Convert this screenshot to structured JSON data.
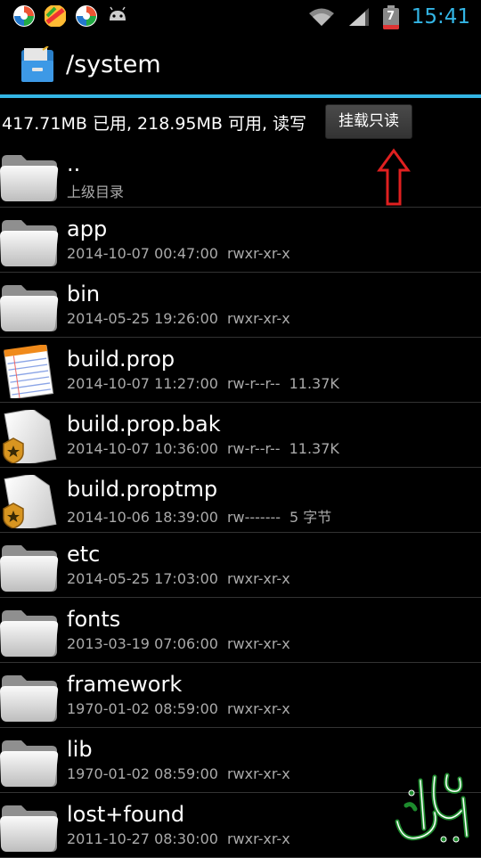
{
  "status_bar": {
    "time": "15:41",
    "battery_level": "7",
    "notification_icons": [
      "app-icon-1",
      "app-icon-2",
      "app-icon-3",
      "android-icon"
    ]
  },
  "header": {
    "title": "/system"
  },
  "storage": {
    "info": "417.71MB 已用, 218.95MB 可用, 读写",
    "mount_button": "挂载只读"
  },
  "files": [
    {
      "name": "..",
      "date": "上级目录",
      "perm": "",
      "size": "",
      "icon": "folder-icon"
    },
    {
      "name": "app",
      "date": "2014-10-07 00:47:00",
      "perm": "rwxr-xr-x",
      "size": "",
      "icon": "folder-icon"
    },
    {
      "name": "bin",
      "date": "2014-05-25 19:26:00",
      "perm": "rwxr-xr-x",
      "size": "",
      "icon": "folder-icon"
    },
    {
      "name": "build.prop",
      "date": "2014-10-07 11:27:00",
      "perm": "rw-r--r--",
      "size": "11.37K",
      "icon": "notepad-icon"
    },
    {
      "name": "build.prop.bak",
      "date": "2014-10-07 10:36:00",
      "perm": "rw-r--r--",
      "size": "11.37K",
      "icon": "file-badge-icon"
    },
    {
      "name": "build.proptmp",
      "date": "2014-10-06 18:39:00",
      "perm": "rw-------",
      "size": "5 字节",
      "icon": "file-badge-icon"
    },
    {
      "name": "etc",
      "date": "2014-05-25 17:03:00",
      "perm": "rwxr-xr-x",
      "size": "",
      "icon": "folder-icon"
    },
    {
      "name": "fonts",
      "date": "2013-03-19 07:06:00",
      "perm": "rwxr-xr-x",
      "size": "",
      "icon": "folder-icon"
    },
    {
      "name": "framework",
      "date": "1970-01-02 08:59:00",
      "perm": "rwxr-xr-x",
      "size": "",
      "icon": "folder-icon"
    },
    {
      "name": "lib",
      "date": "1970-01-02 08:59:00",
      "perm": "rwxr-xr-x",
      "size": "",
      "icon": "folder-icon"
    },
    {
      "name": "lost+found",
      "date": "2011-10-27 08:30:00",
      "perm": "rwxr-xr-x",
      "size": "",
      "icon": "folder-icon"
    }
  ],
  "colors": {
    "accent": "#33b5e5",
    "arrow": "#e02020"
  }
}
